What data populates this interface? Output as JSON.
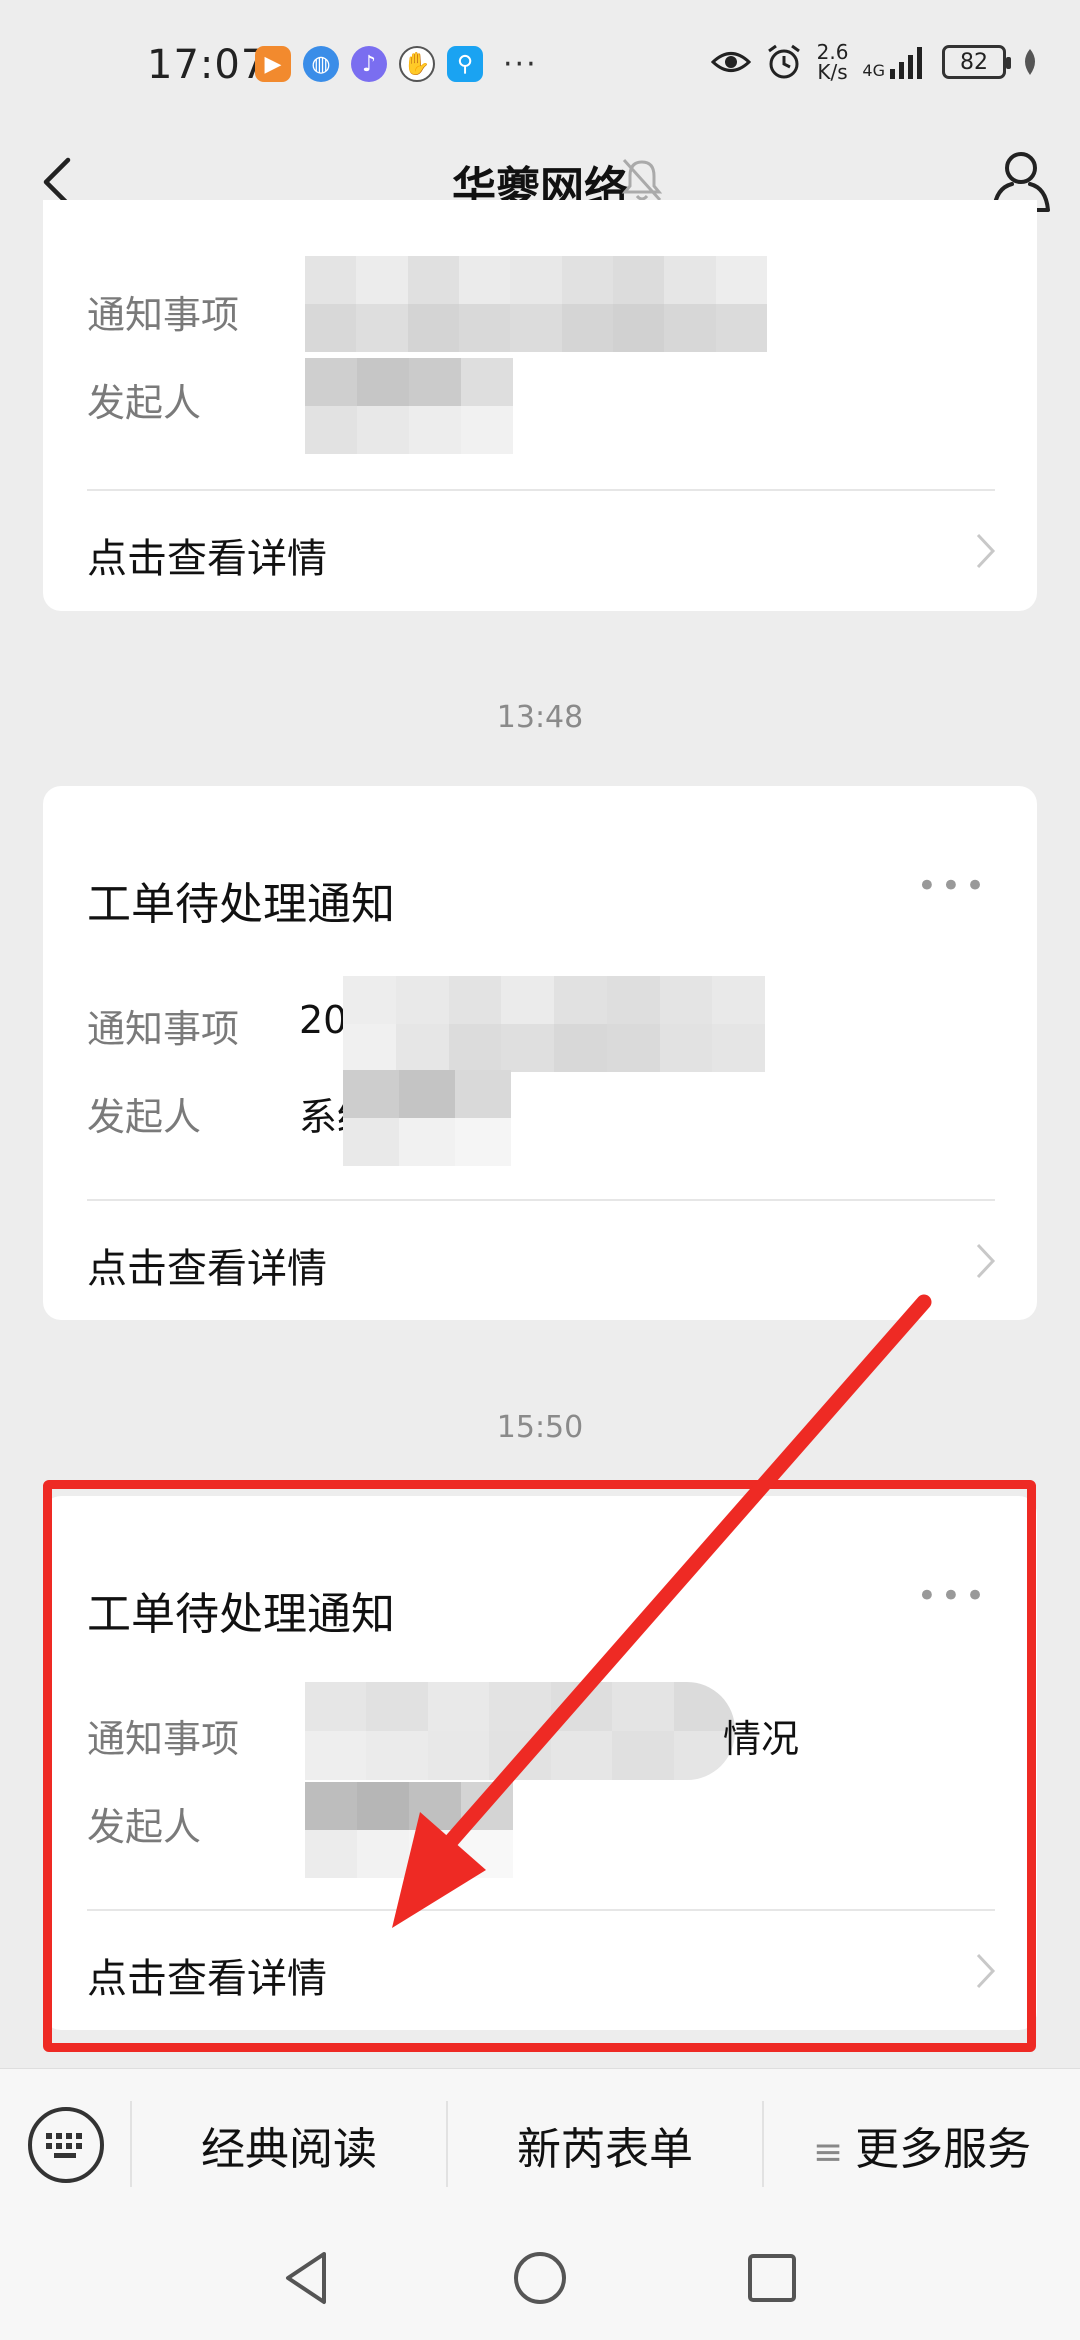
{
  "status_bar": {
    "time": "17:07",
    "more_dots": "···",
    "net_speed_value": "2.6",
    "net_speed_unit": "K/s",
    "network_type": "4G",
    "battery": "82"
  },
  "nav": {
    "title": "华夔网络"
  },
  "cards": [
    {
      "title": "",
      "fields": [
        {
          "label": "通知事项",
          "value": ""
        },
        {
          "label": "发起人",
          "value": ""
        }
      ],
      "detail_link": "点击查看详情"
    },
    {
      "title": "工单待处理通知",
      "fields": [
        {
          "label": "通知事项",
          "value": "20"
        },
        {
          "label": "发起人",
          "value": "系统"
        }
      ],
      "detail_link": "点击查看详情"
    },
    {
      "title": "工单待处理通知",
      "fields": [
        {
          "label": "通知事项",
          "value": "情况"
        },
        {
          "label": "发起人",
          "value": ""
        }
      ],
      "detail_link": "点击查看详情"
    }
  ],
  "timestamps": [
    "13:48",
    "15:50"
  ],
  "card_more": "•••",
  "bottom_menu": {
    "items": [
      "经典阅读",
      "新芮表单",
      "更多服务"
    ],
    "more_icon": "≡"
  },
  "colors": {
    "annotation_red": "#ee2a24",
    "background": "#ededed"
  }
}
